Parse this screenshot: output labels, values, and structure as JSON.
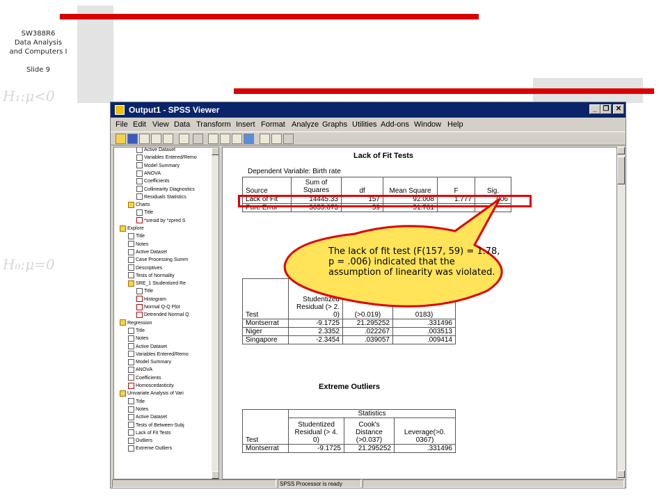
{
  "slide": {
    "header_lines": [
      "SW388R6",
      "Data Analysis",
      "and Computers I",
      "",
      "Slide 9"
    ]
  },
  "window": {
    "title": "Output1 - SPSS Viewer",
    "min": "_",
    "restore": "❐",
    "close": "✕"
  },
  "menu": [
    "File",
    "Edit",
    "View",
    "Data",
    "Transform",
    "Insert",
    "Format",
    "Analyze",
    "Graphs",
    "Utilities",
    "Add-ons",
    "Window",
    "Help"
  ],
  "tree": [
    {
      "label": "Active Dataset",
      "icon": "page"
    },
    {
      "label": "Variables Entered/Remo",
      "icon": "table"
    },
    {
      "label": "Model Summary",
      "icon": "table"
    },
    {
      "label": "ANOVA",
      "icon": "table"
    },
    {
      "label": "Coefficients",
      "icon": "table"
    },
    {
      "label": "Collinearity Diagnostics",
      "icon": "table"
    },
    {
      "label": "Residuals Statistics",
      "icon": "table"
    },
    {
      "label": "Charts",
      "icon": "book"
    },
    {
      "label": "Title",
      "icon": "page"
    },
    {
      "label": "*sresid by *zpred S",
      "icon": "chart"
    },
    {
      "label": "Explore",
      "icon": "book"
    },
    {
      "label": "Title",
      "icon": "page"
    },
    {
      "label": "Notes",
      "icon": "page"
    },
    {
      "label": "Active Dataset",
      "icon": "page"
    },
    {
      "label": "Case Processing Summ",
      "icon": "table"
    },
    {
      "label": "Descriptives",
      "icon": "table"
    },
    {
      "label": "Tests of Normality",
      "icon": "table"
    },
    {
      "label": "SRE_1  Studentized Re",
      "icon": "book"
    },
    {
      "label": "Title",
      "icon": "page"
    },
    {
      "label": "Histogram",
      "icon": "chart"
    },
    {
      "label": "Normal Q-Q Plot",
      "icon": "chart"
    },
    {
      "label": "Detrended Normal Q",
      "icon": "chart"
    },
    {
      "label": "Regression",
      "icon": "book"
    },
    {
      "label": "Title",
      "icon": "page"
    },
    {
      "label": "Notes",
      "icon": "page"
    },
    {
      "label": "Active Dataset",
      "icon": "page"
    },
    {
      "label": "Variables Entered/Remo",
      "icon": "table"
    },
    {
      "label": "Model Summary",
      "icon": "table"
    },
    {
      "label": "ANOVA",
      "icon": "table"
    },
    {
      "label": "Coefficients",
      "icon": "table"
    },
    {
      "label": "Homoscedasticity",
      "icon": "chart"
    },
    {
      "label": "Univariate Analysis of Vari",
      "icon": "book"
    },
    {
      "label": "Title",
      "icon": "page"
    },
    {
      "label": "Notes",
      "icon": "page"
    },
    {
      "label": "Active Dataset",
      "icon": "page"
    },
    {
      "label": "Tests of Between-Subj",
      "icon": "table"
    },
    {
      "label": "Lack of Fit Tests",
      "icon": "table"
    },
    {
      "label": "Outliers",
      "icon": "table"
    },
    {
      "label": "Extreme Outliers",
      "icon": "table"
    }
  ],
  "lof": {
    "title": "Lack of Fit Tests",
    "dependent": "Dependent Variable: Birth rate",
    "headers": [
      "Source",
      "Sum of Squares",
      "df",
      "Mean Square",
      "F",
      "Sig."
    ],
    "rows": [
      [
        "Lack of Fit",
        "14445.33",
        "157",
        "92.008",
        "1.777",
        ".006"
      ],
      [
        "Pure Error",
        "3055.073",
        "59",
        "51.781",
        "",
        ""
      ]
    ]
  },
  "outliers": {
    "col_test": "Test",
    "h1a": "Studentized",
    "h1b": "Residual (> 2.",
    "h1c": "0)",
    "h2": "(>0.019)",
    "h3": "0183)",
    "rows": [
      [
        "Montserrat",
        "-9.1725",
        "21.295252",
        ".331496"
      ],
      [
        "Niger",
        "2.3352",
        ".022267",
        ".003513"
      ],
      [
        "Singapore",
        "-2.3454",
        ".039057",
        ".009414"
      ]
    ]
  },
  "extreme": {
    "title": "Extreme Outliers",
    "statistics": "Statistics",
    "col_test": "Test",
    "h1": [
      "Studentized",
      "Residual (> 4.",
      "0)"
    ],
    "h2": [
      "Cook's",
      "Distance",
      "(>0.037)"
    ],
    "h3": [
      "",
      "Leverage(>0.",
      "0367)"
    ],
    "rows": [
      [
        "Montserrat",
        "-9.1725",
        "21.295252",
        ".331496"
      ]
    ]
  },
  "callout": {
    "text": "The lack of fit test (F(157, 59) = 1.78, p = .006) indicated that the assumption of linearity was violated."
  },
  "status": {
    "text": "SPSS Processor  is ready"
  },
  "colors": {
    "accent_red": "#d90000",
    "callout_fill": "#ffe45a",
    "titlebar": "#0a246a"
  }
}
